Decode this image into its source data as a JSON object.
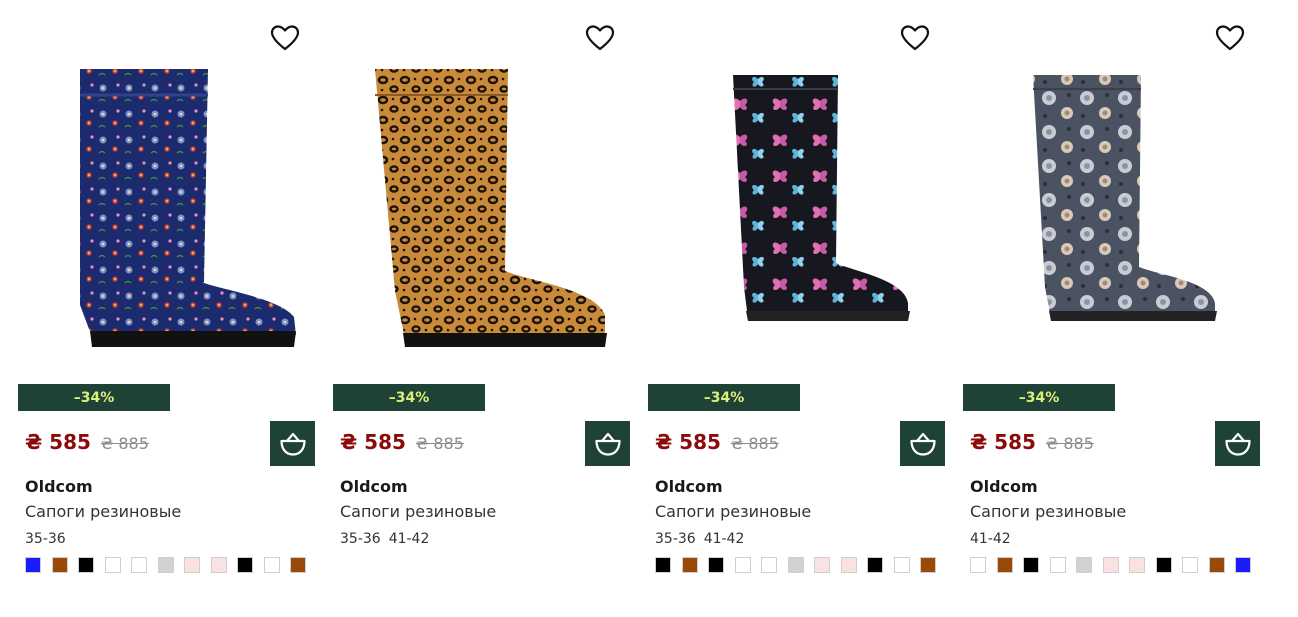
{
  "products": [
    {
      "brand": "Oldcom",
      "name": "Сапоги резиновые",
      "price": "₴ 585",
      "old_price": "₴ 885",
      "discount": "–34%",
      "sizes": [
        "35-36"
      ],
      "swatches": [
        "#1b1bff",
        "#9a4a06",
        "#000000",
        "#ffffff",
        "#ffffff",
        "#d2d2d2",
        "#fbe2e2",
        "#fbe2e2",
        "#000000",
        "#ffffff",
        "#9a4a06"
      ]
    },
    {
      "brand": "Oldcom",
      "name": "Сапоги резиновые",
      "price": "₴ 585",
      "old_price": "₴ 885",
      "discount": "–34%",
      "sizes": [
        "35-36",
        "41-42"
      ],
      "swatches": []
    },
    {
      "brand": "Oldcom",
      "name": "Сапоги резиновые",
      "price": "₴ 585",
      "old_price": "₴ 885",
      "discount": "–34%",
      "sizes": [
        "35-36",
        "41-42"
      ],
      "swatches": [
        "#000000",
        "#9a4a06",
        "#000000",
        "#ffffff",
        "#ffffff",
        "#d2d2d2",
        "#fbe2e2",
        "#fbe2e2",
        "#000000",
        "#ffffff",
        "#9a4a06"
      ]
    },
    {
      "brand": "Oldcom",
      "name": "Сапоги резиновые",
      "price": "₴ 585",
      "old_price": "₴ 885",
      "discount": "–34%",
      "sizes": [
        "41-42"
      ],
      "swatches": [
        "#ffffff",
        "#9a4a06",
        "#000000",
        "#ffffff",
        "#d2d2d2",
        "#fbe2e2",
        "#fbe2e2",
        "#000000",
        "#ffffff",
        "#9a4a06",
        "#1b1bff"
      ]
    }
  ],
  "colors": {
    "accent": "#1f4236",
    "badge_text": "#dcf07a",
    "price": "#8b0a0a"
  }
}
